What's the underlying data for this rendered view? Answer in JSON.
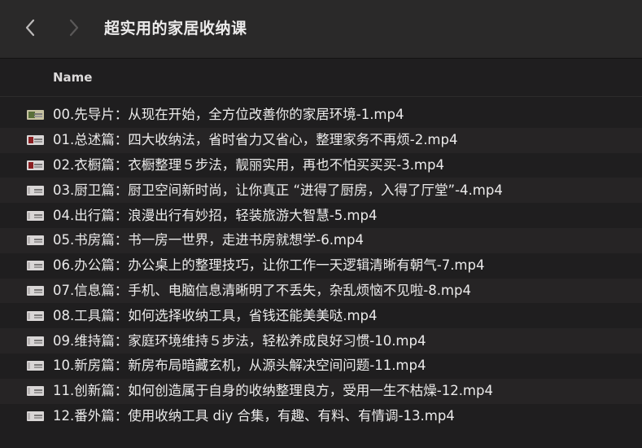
{
  "window": {
    "title": "超实用的家居收纳课"
  },
  "columns": {
    "name": "Name"
  },
  "icons": {
    "back": "chevron-left-icon",
    "forward": "chevron-right-icon",
    "file": "video-thumbnail-icon"
  },
  "files": [
    {
      "name": "00.先导片：从现在开始，全方位改善你的家居环境-1.mp4"
    },
    {
      "name": "01.总述篇：四大收纳法，省时省力又省心，整理家务不再烦-2.mp4"
    },
    {
      "name": "02.衣橱篇：衣橱整理５步法，靓丽实用，再也不怕买买买-3.mp4"
    },
    {
      "name": "03.厨卫篇：厨卫空间新时尚，让你真正 “进得了厨房，入得了厅堂”-4.mp4"
    },
    {
      "name": "04.出行篇：浪漫出行有妙招，轻装旅游大智慧-5.mp4"
    },
    {
      "name": "05.书房篇：书一房一世界，走进书房就想学-6.mp4"
    },
    {
      "name": "06.办公篇：办公桌上的整理技巧，让你工作一天逻辑清晰有朝气-7.mp4"
    },
    {
      "name": "07.信息篇：手机、电脑信息清晰明了不丢失，杂乱烦恼不见啦-8.mp4"
    },
    {
      "name": "08.工具篇：如何选择收纳工具，省钱还能美美哒.mp4"
    },
    {
      "name": "09.维持篇：家庭环境维持５步法，轻松养成良好习惯-10.mp4"
    },
    {
      "name": "10.新房篇：新房布局暗藏玄机，从源头解决空间问题-11.mp4"
    },
    {
      "name": "11.创新篇：如何创造属于自身的收纳整理良方，受用一生不枯燥-12.mp4"
    },
    {
      "name": "12.番外篇：使用收纳工具 diy 合集，有趣、有料、有情调-13.mp4"
    }
  ]
}
